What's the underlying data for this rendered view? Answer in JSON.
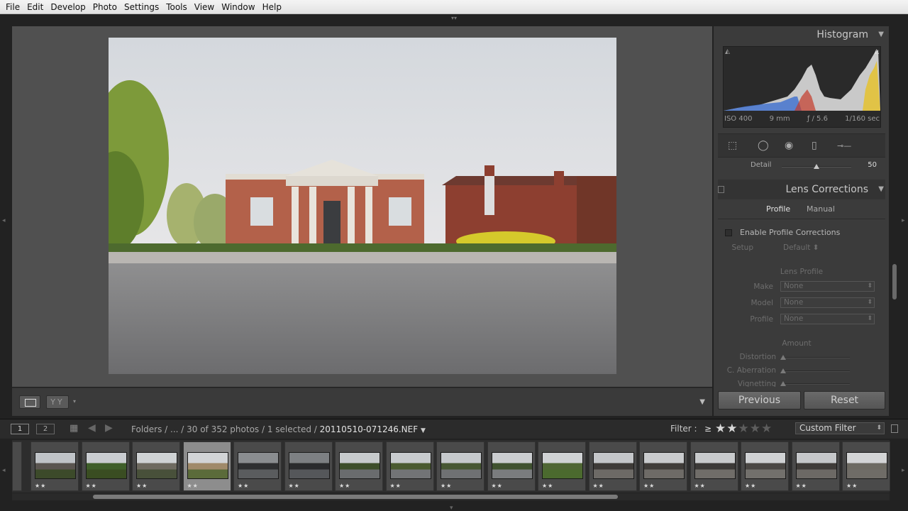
{
  "menubar": {
    "items": [
      "File",
      "Edit",
      "Develop",
      "Photo",
      "Settings",
      "Tools",
      "View",
      "Window",
      "Help"
    ]
  },
  "histogram": {
    "title": "Histogram",
    "iso": "ISO 400",
    "focal": "9 mm",
    "aperture": "ƒ / 5.6",
    "shutter": "1/160 sec"
  },
  "detail": {
    "label": "Detail",
    "value": "50",
    "level": 0.5
  },
  "lens_corrections": {
    "title": "Lens Corrections",
    "tabs": [
      "Profile",
      "Manual"
    ],
    "active_tab": "Profile",
    "enable_label": "Enable Profile Corrections",
    "setup_label": "Setup",
    "setup_value": "Default",
    "lens_profile_heading": "Lens Profile",
    "make_label": "Make",
    "make_value": "None",
    "model_label": "Model",
    "model_value": "None",
    "profile_label": "Profile",
    "profile_value": "None",
    "amount_heading": "Amount",
    "distortion_label": "Distortion",
    "aberration_label": "C. Aberration",
    "vignetting_label": "Vignetting"
  },
  "buttons": {
    "previous": "Previous",
    "reset": "Reset"
  },
  "filmbar": {
    "monitor1": "1",
    "monitor2": "2",
    "path": "Folders / ... / 30 of 352 photos / 1 selected /",
    "filename": "20110510-071246.NEF",
    "filter_label": "Filter :",
    "rating_op": "≥",
    "rating": 2,
    "stars": "★★★★★",
    "custom_filter": "Custom Filter"
  },
  "filmstrip": {
    "thumb_stars": "★★",
    "count": 17
  },
  "colors": {
    "panel_bg": "#3b3b3b",
    "center_bg": "#505050",
    "menubar_bg": "#f0f0f0"
  }
}
